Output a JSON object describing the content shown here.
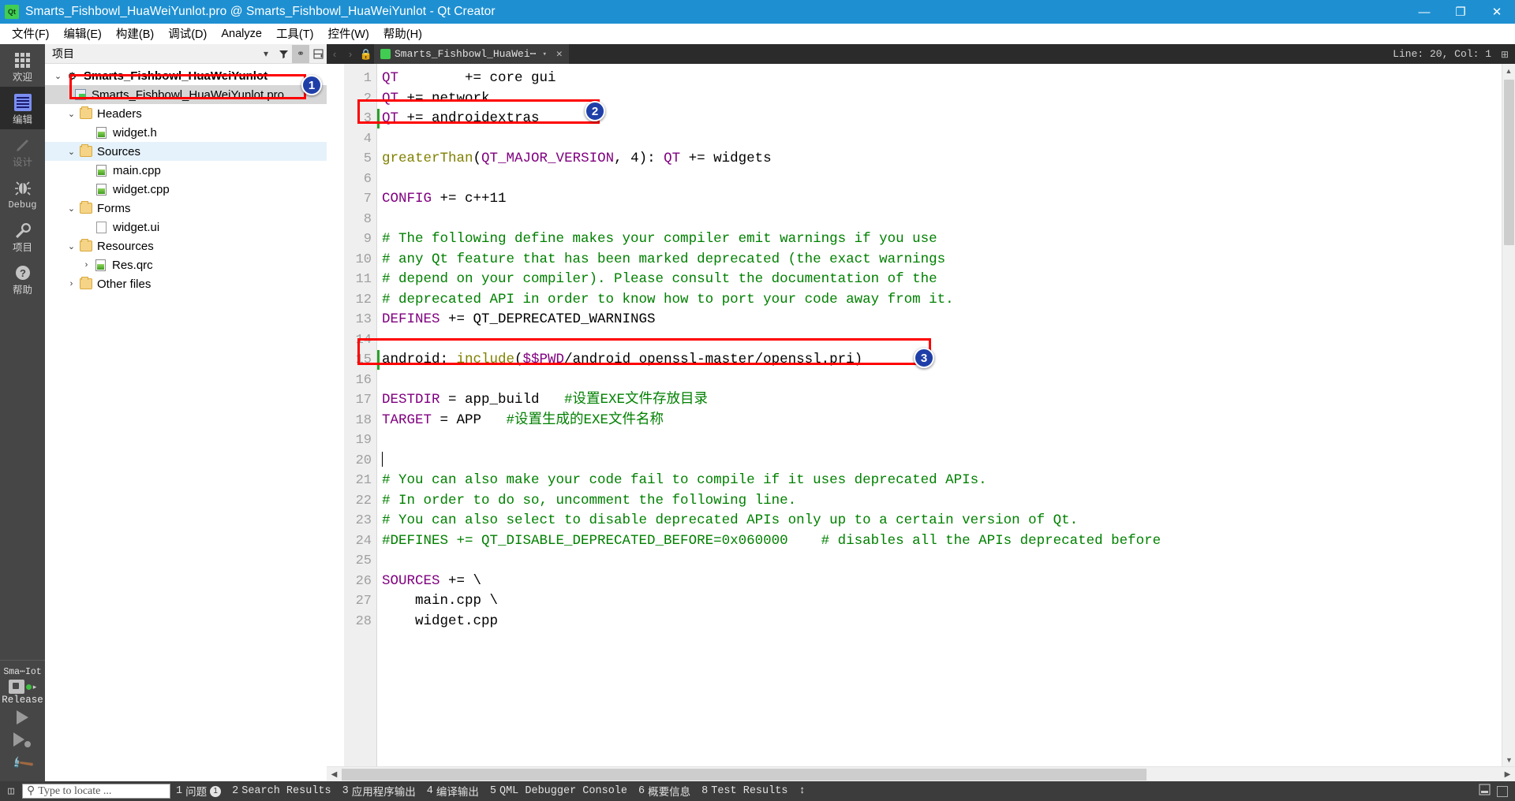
{
  "window": {
    "title": "Smarts_Fishbowl_HuaWeiYunlot.pro @ Smarts_Fishbowl_HuaWeiYunlot - Qt Creator",
    "logo_text": "Qt",
    "minimize": "—",
    "maximize": "❐",
    "close": "✕",
    "titlebar_color": "#1e90d2"
  },
  "menubar": {
    "items": [
      {
        "label": "文件(F)"
      },
      {
        "label": "编辑(E)"
      },
      {
        "label": "构建(B)"
      },
      {
        "label": "调试(D)"
      },
      {
        "label": "Analyze"
      },
      {
        "label": "工具(T)"
      },
      {
        "label": "控件(W)"
      },
      {
        "label": "帮助(H)"
      }
    ]
  },
  "modebar": {
    "items": [
      {
        "label": "欢迎",
        "icon": "grid-icon",
        "state": "normal"
      },
      {
        "label": "编辑",
        "icon": "edit-document-icon",
        "state": "active"
      },
      {
        "label": "设计",
        "icon": "pencil-icon",
        "state": "disabled"
      },
      {
        "label": "Debug",
        "icon": "bug-icon",
        "state": "normal"
      },
      {
        "label": "项目",
        "icon": "wrench-icon",
        "state": "normal"
      },
      {
        "label": "帮助",
        "icon": "question-mark-icon",
        "state": "normal"
      }
    ],
    "kit": {
      "name": "Sma⋯Iot",
      "build_config": "Release"
    },
    "actions": [
      {
        "name": "run-button",
        "icon": "play-icon"
      },
      {
        "name": "debug-button",
        "icon": "play-bug-icon"
      },
      {
        "name": "build-button",
        "icon": "hammer-icon"
      }
    ]
  },
  "dock": {
    "title": "项目",
    "toolbar": [
      {
        "name": "filter-dropdown",
        "glyph": "▾"
      },
      {
        "name": "filter-icon",
        "glyph": "ᴛ"
      },
      {
        "name": "sync-with-editor-icon",
        "glyph": "⚭"
      },
      {
        "name": "split-icon",
        "glyph": "▤"
      }
    ],
    "tree": [
      {
        "label": "Smarts_Fishbowl_HuaWeiYunlot",
        "indent": 0,
        "chevron": "⌄",
        "icon": "project-icon",
        "bold": true,
        "state": "normal"
      },
      {
        "label": "Smarts_Fishbowl_HuaWeiYunlot.pro",
        "indent": 1,
        "chevron": "",
        "icon": "pro-file-icon",
        "bold": false,
        "state": "selected"
      },
      {
        "label": "Headers",
        "indent": 1,
        "chevron": "⌄",
        "icon": "folder-h-icon",
        "bold": false,
        "state": "normal"
      },
      {
        "label": "widget.h",
        "indent": 2,
        "chevron": "",
        "icon": "source-file-icon",
        "bold": false,
        "state": "normal"
      },
      {
        "label": "Sources",
        "indent": 1,
        "chevron": "⌄",
        "icon": "folder-cpp-icon",
        "bold": false,
        "state": "highlight"
      },
      {
        "label": "main.cpp",
        "indent": 2,
        "chevron": "",
        "icon": "source-file-icon",
        "bold": false,
        "state": "normal"
      },
      {
        "label": "widget.cpp",
        "indent": 2,
        "chevron": "",
        "icon": "source-file-icon",
        "bold": false,
        "state": "normal"
      },
      {
        "label": "Forms",
        "indent": 1,
        "chevron": "⌄",
        "icon": "folder-ui-icon",
        "bold": false,
        "state": "normal"
      },
      {
        "label": "widget.ui",
        "indent": 2,
        "chevron": "",
        "icon": "ui-file-icon",
        "bold": false,
        "state": "normal"
      },
      {
        "label": "Resources",
        "indent": 1,
        "chevron": "⌄",
        "icon": "folder-qrc-icon",
        "bold": false,
        "state": "normal"
      },
      {
        "label": "Res.qrc",
        "indent": 2,
        "chevron": "›",
        "icon": "qrc-file-icon",
        "bold": false,
        "state": "normal"
      },
      {
        "label": "Other files",
        "indent": 1,
        "chevron": "›",
        "icon": "folder-other-icon",
        "bold": false,
        "state": "normal"
      }
    ]
  },
  "editor": {
    "tab": {
      "label": "Smarts_Fishbowl_HuaWei⋯",
      "dropdown": "▾",
      "close": "✕"
    },
    "nav_back": "‹",
    "nav_forward": "›",
    "cursor_position": "Line: 20, Col: 1",
    "split_icon": "⊞",
    "lines": [
      {
        "n": 1,
        "tokens": [
          {
            "t": "QT",
            "c": "kw"
          },
          {
            "t": "        += core gui",
            "c": "op"
          }
        ]
      },
      {
        "n": 2,
        "tokens": [
          {
            "t": "QT",
            "c": "kw"
          },
          {
            "t": " += network",
            "c": "op"
          }
        ]
      },
      {
        "n": 3,
        "tokens": [
          {
            "t": "QT",
            "c": "kw"
          },
          {
            "t": " += androidextras",
            "c": "op"
          }
        ]
      },
      {
        "n": 4,
        "tokens": []
      },
      {
        "n": 5,
        "tokens": [
          {
            "t": "greaterThan",
            "c": "fn"
          },
          {
            "t": "(",
            "c": "op"
          },
          {
            "t": "QT_MAJOR_VERSION",
            "c": "kw"
          },
          {
            "t": ", 4): ",
            "c": "op"
          },
          {
            "t": "QT",
            "c": "kw"
          },
          {
            "t": " += widgets",
            "c": "op"
          }
        ]
      },
      {
        "n": 6,
        "tokens": []
      },
      {
        "n": 7,
        "tokens": [
          {
            "t": "CONFIG",
            "c": "kw"
          },
          {
            "t": " += c++11",
            "c": "op"
          }
        ]
      },
      {
        "n": 8,
        "tokens": []
      },
      {
        "n": 9,
        "tokens": [
          {
            "t": "# The following define makes your compiler emit warnings if you use",
            "c": "cm"
          }
        ]
      },
      {
        "n": 10,
        "tokens": [
          {
            "t": "# any Qt feature that has been marked deprecated (the exact warnings",
            "c": "cm"
          }
        ]
      },
      {
        "n": 11,
        "tokens": [
          {
            "t": "# depend on your compiler). Please consult the documentation of the",
            "c": "cm"
          }
        ]
      },
      {
        "n": 12,
        "tokens": [
          {
            "t": "# deprecated API in order to know how to port your code away from it.",
            "c": "cm"
          }
        ]
      },
      {
        "n": 13,
        "tokens": [
          {
            "t": "DEFINES",
            "c": "kw"
          },
          {
            "t": " += QT_DEPRECATED_WARNINGS",
            "c": "op"
          }
        ]
      },
      {
        "n": 14,
        "tokens": []
      },
      {
        "n": 15,
        "tokens": [
          {
            "t": "android: ",
            "c": "op"
          },
          {
            "t": "include",
            "c": "fn"
          },
          {
            "t": "(",
            "c": "op"
          },
          {
            "t": "$$PWD",
            "c": "kw"
          },
          {
            "t": "/android_openssl-master/openssl.pri)",
            "c": "op"
          }
        ]
      },
      {
        "n": 16,
        "tokens": []
      },
      {
        "n": 17,
        "tokens": [
          {
            "t": "DESTDIR",
            "c": "kw"
          },
          {
            "t": " = app_build   ",
            "c": "op"
          },
          {
            "t": "#设置EXE文件存放目录",
            "c": "cm"
          }
        ]
      },
      {
        "n": 18,
        "tokens": [
          {
            "t": "TARGET",
            "c": "kw"
          },
          {
            "t": " = APP   ",
            "c": "op"
          },
          {
            "t": "#设置生成的EXE文件名称",
            "c": "cm"
          }
        ]
      },
      {
        "n": 19,
        "tokens": []
      },
      {
        "n": 20,
        "tokens": [],
        "caret": true
      },
      {
        "n": 21,
        "tokens": [
          {
            "t": "# You can also make your code fail to compile if it uses deprecated APIs.",
            "c": "cm"
          }
        ]
      },
      {
        "n": 22,
        "tokens": [
          {
            "t": "# In order to do so, uncomment the following line.",
            "c": "cm"
          }
        ]
      },
      {
        "n": 23,
        "tokens": [
          {
            "t": "# You can also select to disable deprecated APIs only up to a certain version of Qt.",
            "c": "cm"
          }
        ]
      },
      {
        "n": 24,
        "tokens": [
          {
            "t": "#DEFINES += QT_DISABLE_DEPRECATED_BEFORE=0x060000    # disables all the APIs deprecated before",
            "c": "cm"
          }
        ]
      },
      {
        "n": 25,
        "tokens": []
      },
      {
        "n": 26,
        "tokens": [
          {
            "t": "SOURCES",
            "c": "kw"
          },
          {
            "t": " += \\",
            "c": "op"
          }
        ]
      },
      {
        "n": 27,
        "tokens": [
          {
            "t": "    main.cpp \\",
            "c": "op"
          }
        ]
      },
      {
        "n": 28,
        "tokens": [
          {
            "t": "    widget.cpp",
            "c": "op"
          }
        ]
      }
    ]
  },
  "statusbar": {
    "locator_placeholder": "Type to locate ...",
    "search_icon": "⚲",
    "toggle_sidebar_icon": "◫",
    "items": [
      {
        "num": "1",
        "label": "问题",
        "badge": "1"
      },
      {
        "num": "2",
        "label": "Search Results",
        "badge": ""
      },
      {
        "num": "3",
        "label": "应用程序输出",
        "badge": ""
      },
      {
        "num": "4",
        "label": "编译输出",
        "badge": ""
      },
      {
        "num": "5",
        "label": "QML Debugger Console",
        "badge": ""
      },
      {
        "num": "6",
        "label": "概要信息",
        "badge": ""
      },
      {
        "num": "8",
        "label": "Test Results",
        "badge": ""
      }
    ],
    "more_glyph": "↕",
    "right_icons": [
      {
        "name": "output-pane-toggle-icon",
        "glyph": "⬒"
      },
      {
        "name": "maximize-output-icon",
        "glyph": "▭"
      }
    ]
  },
  "annotations": [
    {
      "number": "1",
      "target": "pro-file-tree-row"
    },
    {
      "number": "2",
      "target": "code-line-3-androidextras"
    },
    {
      "number": "3",
      "target": "code-line-15-android-include"
    }
  ]
}
